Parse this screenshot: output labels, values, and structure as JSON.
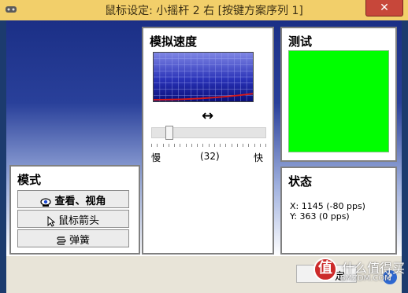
{
  "window": {
    "title": "鼠标设定: 小摇杆 2 右 [按键方案序列 1]",
    "close_symbol": "✕"
  },
  "mode_panel": {
    "title": "模式",
    "buttons": [
      {
        "label": "查看、视角",
        "icon": "eye-icon"
      },
      {
        "label": "鼠标箭头",
        "icon": "cursor-arrow-icon"
      },
      {
        "label": "弹簧",
        "icon": "spring-icon"
      }
    ]
  },
  "speed_panel": {
    "title": "模拟速度",
    "arrows_symbol": "↔",
    "slow_label": "慢",
    "fast_label": "快",
    "value_label": "(32)",
    "slider_fraction": 0.12
  },
  "test_panel": {
    "title": "测试",
    "color": "#00ff00"
  },
  "status_panel": {
    "title": "状态",
    "x_line": "X: 1145   (-80 pps)",
    "y_line": "Y: 363   (0 pps)"
  },
  "bottom": {
    "ok_label": "确定",
    "ok_visible_label": "定",
    "help_symbol": "?"
  },
  "watermark": {
    "badge": "值",
    "line1": "什么值得买",
    "line2": "SMZDM.COM"
  }
}
